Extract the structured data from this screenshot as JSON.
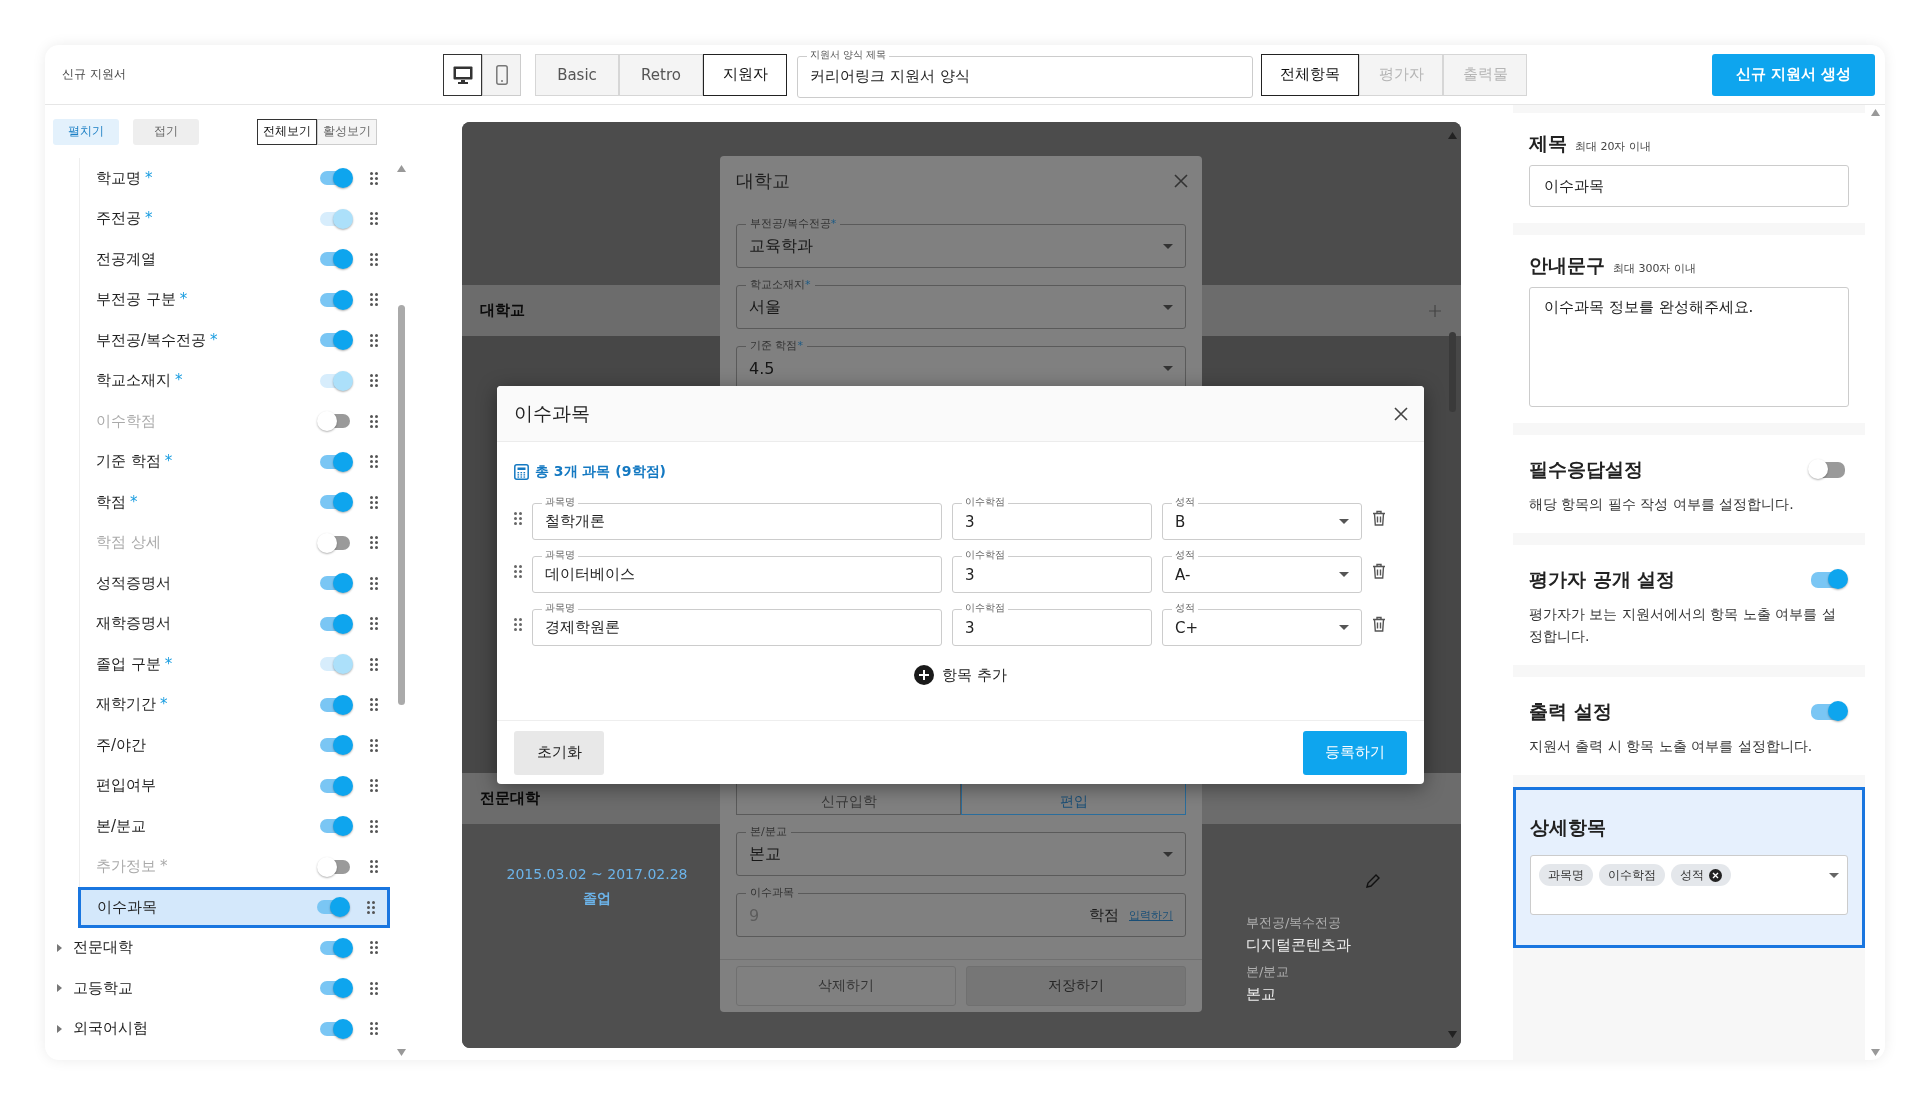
{
  "header": {
    "title": "신규 지원서"
  },
  "device_toggle": [
    {
      "kind": "desktop",
      "selected": true
    },
    {
      "kind": "mobile",
      "selected": false
    }
  ],
  "view_tabs": [
    {
      "label": "Basic",
      "selected": false
    },
    {
      "label": "Retro",
      "selected": false
    },
    {
      "label": "지원자",
      "selected": true
    }
  ],
  "form_title_field": {
    "label": "지원서 양식 제목",
    "value": "커리어링크 지원서 양식"
  },
  "filter_tabs": [
    {
      "label": "전체항목",
      "selected": true,
      "disabled": false
    },
    {
      "label": "평가자",
      "selected": false,
      "disabled": true
    },
    {
      "label": "출력물",
      "selected": false,
      "disabled": true
    }
  ],
  "create_button": "신규 지원서 생성",
  "sidebar": {
    "expand_buttons": [
      {
        "label": "펼치기",
        "selected": true
      },
      {
        "label": "접기",
        "selected": false
      }
    ],
    "view_filter": [
      {
        "label": "전체보기",
        "selected": true
      },
      {
        "label": "활성보기",
        "selected": false
      }
    ],
    "nested_items": [
      {
        "label": "학교명",
        "required_mark": "*",
        "on": true,
        "locked": false,
        "selected": false
      },
      {
        "label": "주전공",
        "required_mark": "*",
        "on": true,
        "locked": true,
        "selected": false
      },
      {
        "label": "전공계열",
        "on": true,
        "locked": false,
        "selected": false
      },
      {
        "label": "부전공 구분",
        "required_mark": "*",
        "on": true,
        "locked": false,
        "selected": false
      },
      {
        "label": "부전공/복수전공",
        "required_mark": "*",
        "on": true,
        "locked": false,
        "selected": false
      },
      {
        "label": "학교소재지",
        "required_mark": "*",
        "on": true,
        "locked": true,
        "selected": false
      },
      {
        "label": "이수학점",
        "on": false,
        "locked": false,
        "selected": false
      },
      {
        "label": "기준 학점",
        "required_mark": "*",
        "on": true,
        "locked": false,
        "selected": false
      },
      {
        "label": "학점",
        "required_mark": "*",
        "on": true,
        "locked": false,
        "selected": false
      },
      {
        "label": "학점 상세",
        "on": false,
        "locked": false,
        "selected": false
      },
      {
        "label": "성적증명서",
        "on": true,
        "locked": false,
        "selected": false
      },
      {
        "label": "재학증명서",
        "on": true,
        "locked": false,
        "selected": false
      },
      {
        "label": "졸업 구분",
        "required_mark": "*",
        "on": true,
        "locked": true,
        "selected": false
      },
      {
        "label": "재학기간",
        "required_mark": "*",
        "on": true,
        "locked": false,
        "selected": false
      },
      {
        "label": "주/야간",
        "on": true,
        "locked": false,
        "selected": false
      },
      {
        "label": "편입여부",
        "on": true,
        "locked": false,
        "selected": false
      },
      {
        "label": "본/분교",
        "on": true,
        "locked": false,
        "selected": false
      },
      {
        "label": "추가정보",
        "required_mark": "*",
        "on": false,
        "locked": false,
        "selected": false
      },
      {
        "label": "이수과목",
        "on": true,
        "locked": false,
        "selected": true
      }
    ],
    "groups": [
      {
        "label": "전문대학",
        "expanded": false,
        "on": true
      },
      {
        "label": "고등학교",
        "expanded": false,
        "on": true
      },
      {
        "label": "외국어시험",
        "expanded": false,
        "on": true
      }
    ]
  },
  "preview": {
    "sections": [
      {
        "title": "대학교"
      },
      {
        "title": "전문대학"
      }
    ],
    "entry": {
      "period": "2015.03.02 ~ 2017.02.28",
      "status": "졸업",
      "fields": [
        {
          "label": "부전공/복수전공",
          "value": "디지털콘텐츠과"
        },
        {
          "label": "본/분교",
          "value": "본교"
        }
      ]
    },
    "back_modal": {
      "title": "대학교",
      "selects": [
        {
          "label": "부전공/복수전공",
          "required": true,
          "value": "교육학과"
        },
        {
          "label": "학교소재지",
          "required": true,
          "value": "서울"
        },
        {
          "label": "기준 학점",
          "required": true,
          "value": "4.5"
        }
      ],
      "admission_type": [
        {
          "label": "신규입학",
          "selected": false
        },
        {
          "label": "편입",
          "selected": true
        }
      ],
      "campus": {
        "label": "본/분교",
        "value": "본교"
      },
      "courses_field": {
        "label": "이수과목",
        "value": "9",
        "unit": "학점",
        "link": "입력하기"
      },
      "buttons": [
        "삭제하기",
        "저장하기"
      ]
    },
    "courses_modal": {
      "title": "이수과목",
      "summary": "총 3개 과목 (9학점)",
      "rows": [
        {
          "name_label": "과목명",
          "name": "철학개론",
          "credits_label": "이수학점",
          "credits": "3",
          "grade_label": "성적",
          "grade": "B"
        },
        {
          "name_label": "과목명",
          "name": "데이터베이스",
          "credits_label": "이수학점",
          "credits": "3",
          "grade_label": "성적",
          "grade": "A-"
        },
        {
          "name_label": "과목명",
          "name": "경제학원론",
          "credits_label": "이수학점",
          "credits": "3",
          "grade_label": "성적",
          "grade": "C+"
        }
      ],
      "add_button": "항목 추가",
      "reset_button": "초기화",
      "submit_button": "등록하기"
    }
  },
  "settings": {
    "title_card": {
      "label": "제목",
      "hint": "최대 20자 이내",
      "value": "이수과목"
    },
    "guide_card": {
      "label": "안내문구",
      "hint": "최대 300자 이내",
      "value": "이수과목 정보를 완성해주세요."
    },
    "toggles": [
      {
        "title": "필수응답설정",
        "description": "해당 항목의 필수 작성 여부를 설정합니다.",
        "on": false
      },
      {
        "title": "평가자 공개 설정",
        "description": "평가자가 보는 지원서에서의 항목 노출 여부를 설정합니다.",
        "on": true
      },
      {
        "title": "출력 설정",
        "description": "지원서 출력 시 항목 노출 여부를 설정합니다.",
        "on": true
      }
    ],
    "detail_card": {
      "title": "상세항목",
      "selected": true,
      "chips": [
        {
          "label": "과목명",
          "removable": false
        },
        {
          "label": "이수학점",
          "removable": false
        },
        {
          "label": "성적",
          "removable": true
        }
      ]
    }
  }
}
